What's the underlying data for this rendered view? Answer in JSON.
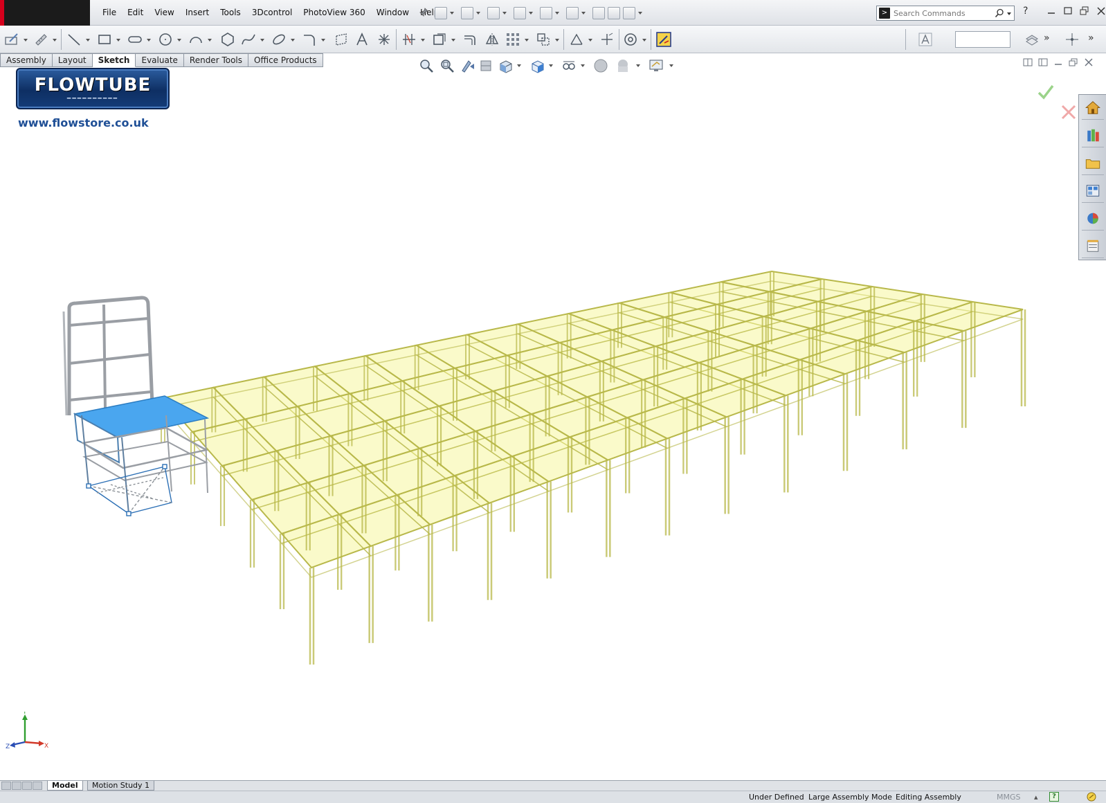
{
  "menu": {
    "items": [
      "File",
      "Edit",
      "View",
      "Insert",
      "Tools",
      "3Dcontrol",
      "PhotoView 360",
      "Window",
      "Help"
    ]
  },
  "search": {
    "placeholder": "Search Commands"
  },
  "tabs": [
    {
      "label": "Assembly",
      "active": false
    },
    {
      "label": "Layout",
      "active": false
    },
    {
      "label": "Sketch",
      "active": true
    },
    {
      "label": "Evaluate",
      "active": false
    },
    {
      "label": "Render Tools",
      "active": false
    },
    {
      "label": "Office Products",
      "active": false
    }
  ],
  "logo": {
    "title": "FLOWTUBE",
    "url": "www.flowstore.co.uk"
  },
  "triad": {
    "x": "X",
    "y": "Y",
    "z": "Z"
  },
  "bottom_tabs": [
    {
      "label": "Model",
      "active": true
    },
    {
      "label": "Motion Study 1",
      "active": false
    }
  ],
  "status": {
    "definition": "Under Defined",
    "mode": "Large Assembly Mode",
    "editing": "Editing Assembly",
    "units": "MMGS"
  },
  "colors": {
    "platform_fill": "#f4f48a",
    "platform_stroke": "#b8b84a",
    "selected": "#4aa6ef",
    "rail": "#9a9ea4"
  },
  "icons": {
    "toolbar": [
      "sketch-icon",
      "smart-dimension-icon",
      "line-icon",
      "rectangle-icon",
      "slot-icon",
      "circle-icon",
      "arc-icon",
      "polygon-icon",
      "spline-icon",
      "ellipse-icon",
      "fillet-icon",
      "plane-icon",
      "text-icon",
      "point-icon",
      "trim-icon",
      "convert-icon",
      "offset-icon",
      "mirror-icon",
      "pattern-icon",
      "move-icon",
      "relations-icon",
      "repair-icon",
      "quick-snaps-icon",
      "rapid-sketch-icon"
    ],
    "task_pane": [
      "home-icon",
      "design-library-icon",
      "file-explorer-icon",
      "view-palette-icon",
      "appearances-icon",
      "custom-properties-icon"
    ]
  }
}
